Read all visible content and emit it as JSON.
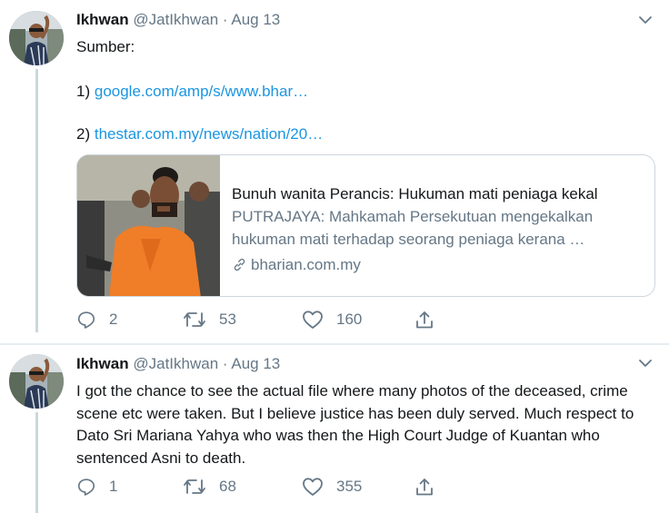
{
  "tweets": [
    {
      "author": {
        "name": "Ikhwan",
        "handle": "@JatIkhwan",
        "separator": "·",
        "date": "Aug 13"
      },
      "source_label": "Sumber:",
      "links": [
        {
          "prefix": "1)",
          "text": "google.com/amp/s/www.bhar…"
        },
        {
          "prefix": "2)",
          "text": "thestar.com.my/news/nation/20…"
        }
      ],
      "card": {
        "title": "Bunuh wanita Perancis: Hukuman mati peniaga kekal",
        "description": "PUTRAJAYA: Mahkamah Persekutuan mengekalkan hukuman mati terhadap seorang peniaga kerana …",
        "domain": "bharian.com.my"
      },
      "stats": {
        "replies": "2",
        "retweets": "53",
        "likes": "160"
      }
    },
    {
      "author": {
        "name": "Ikhwan",
        "handle": "@JatIkhwan",
        "separator": "·",
        "date": "Aug 13"
      },
      "text": "I got the chance to see the actual file where many photos of the deceased, crime scene etc were taken. But I believe justice has been duly served. Much respect to Dato Sri Mariana Yahya who was then the High Court Judge of Kuantan who sentenced Asni to death.",
      "stats": {
        "replies": "1",
        "retweets": "68",
        "likes": "355"
      }
    }
  ],
  "icons": {
    "menu": "chevron-down-icon",
    "reply": "reply-icon",
    "retweet": "retweet-icon",
    "like": "heart-icon",
    "share": "share-icon",
    "link": "link-icon"
  },
  "colors": {
    "link": "#1b95e0",
    "secondary_text": "#657786",
    "border": "#ccd6dd",
    "text": "#14171a"
  }
}
